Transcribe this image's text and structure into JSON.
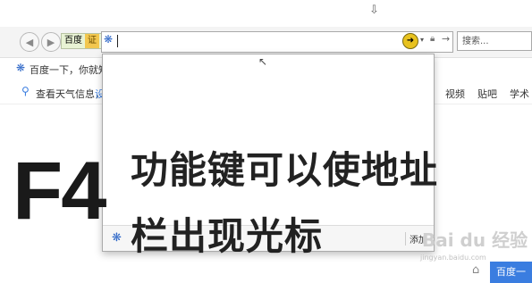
{
  "toolbar": {
    "compat_label": "百度",
    "compat_mode": "证",
    "search_placeholder": "搜索..."
  },
  "page": {
    "top_item": "百度一下，你就知道",
    "weather_text": "查看天气信息，",
    "weather_link": "设",
    "nav_links": [
      "视频",
      "贴吧",
      "学术"
    ]
  },
  "dropdown": {
    "footer_button": "添加"
  },
  "overlay": {
    "key": "F4",
    "caption_line1": "功能键可以使地址",
    "caption_line2": "栏出现光标"
  },
  "watermark": {
    "brand": "Bai du 经验",
    "url": "jingyan.baidu.com"
  },
  "footer": {
    "home_button": "百度一"
  },
  "colors": {
    "accent": "#3a7de0",
    "text": "#222222"
  }
}
